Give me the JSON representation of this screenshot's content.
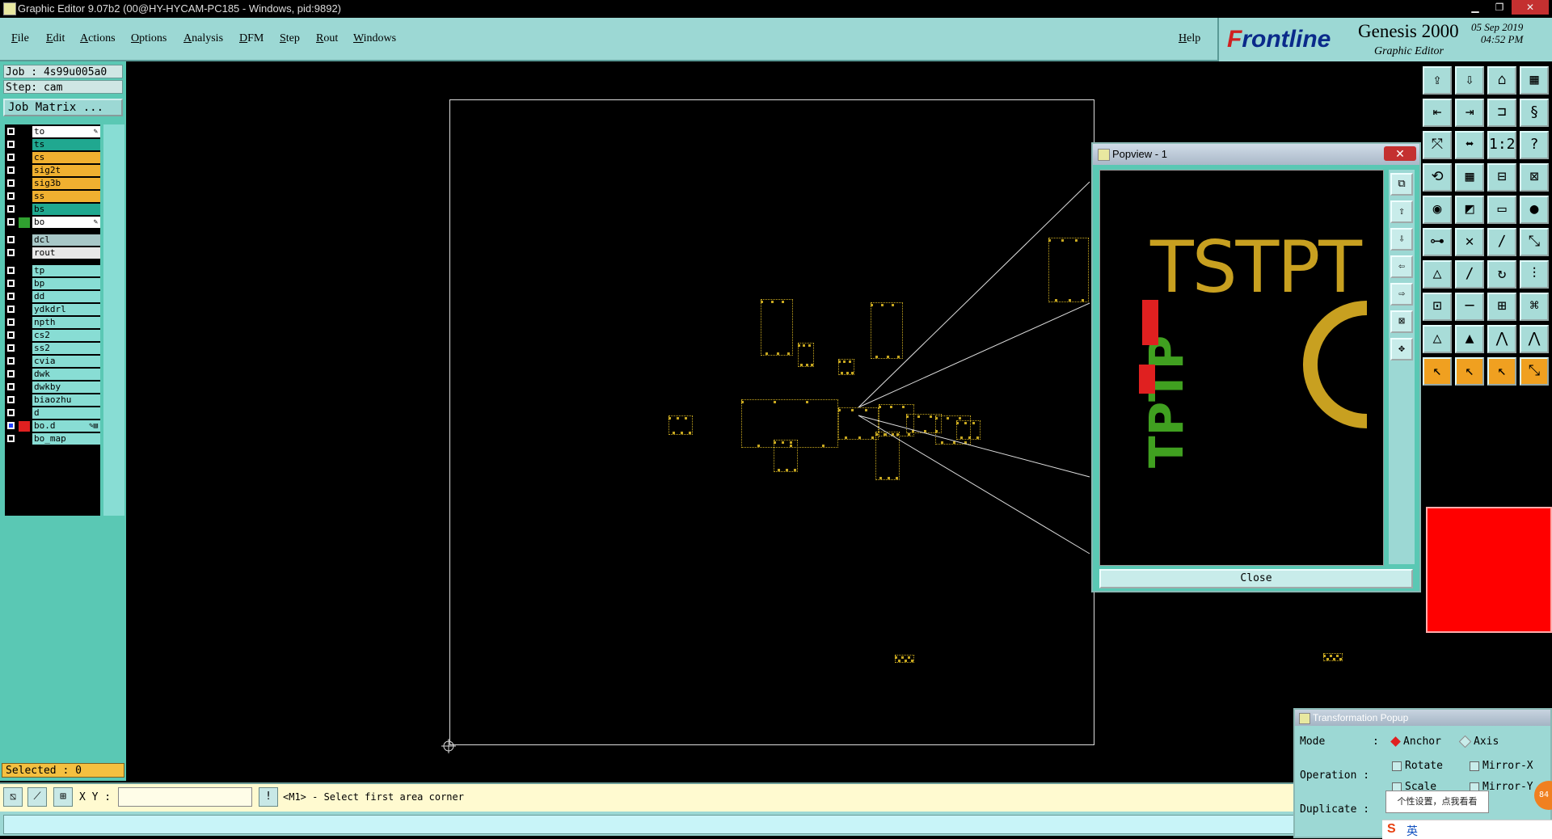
{
  "window": {
    "title": "Graphic Editor 9.07b2 (00@HY-HYCAM-PC185 - Windows, pid:9892)",
    "min": "▁",
    "max": "❐",
    "close": "✕"
  },
  "menu": {
    "items": [
      "File",
      "Edit",
      "Actions",
      "Options",
      "Analysis",
      "DFM",
      "Step",
      "Rout",
      "Windows"
    ],
    "help": "Help"
  },
  "brand": {
    "logo_prefix": "F",
    "logo_rest": "rontline",
    "product": "Genesis 2000",
    "subtitle": "Graphic Editor",
    "date_line1": "05 Sep 2019",
    "date_line2": "04:52 PM"
  },
  "leftpanel": {
    "job": "Job : 4s99u005a0",
    "step": "Step: cam",
    "job_matrix": "Job Matrix ...",
    "selected": "Selected : 0"
  },
  "layers": [
    {
      "name": "to",
      "bg": "#ffffff",
      "swatch": "#000000",
      "pen": "✎"
    },
    {
      "name": "ts",
      "bg": "#20a890",
      "swatch": "#000000"
    },
    {
      "name": "cs",
      "bg": "#f0b030",
      "swatch": "#000000"
    },
    {
      "name": "sig2t",
      "bg": "#f0b030",
      "swatch": "#000000"
    },
    {
      "name": "sig3b",
      "bg": "#f0b030",
      "swatch": "#000000"
    },
    {
      "name": "ss",
      "bg": "#f0b030",
      "swatch": "#000000"
    },
    {
      "name": "bs",
      "bg": "#20a890",
      "swatch": "#000000"
    },
    {
      "name": "bo",
      "bg": "#ffffff",
      "swatch": "#30a030",
      "pen": "✎"
    },
    {
      "name": "dcl",
      "bg": "#a8c8c8",
      "swatch": "#000000"
    },
    {
      "name": "rout",
      "bg": "#e8e8e8",
      "swatch": "#000000"
    },
    {
      "name": "tp",
      "bg": "#88ddd4",
      "swatch": "#000000"
    },
    {
      "name": "bp",
      "bg": "#88ddd4",
      "swatch": "#000000"
    },
    {
      "name": "dd",
      "bg": "#88ddd4",
      "swatch": "#000000"
    },
    {
      "name": "ydkdrl",
      "bg": "#88ddd4",
      "swatch": "#000000"
    },
    {
      "name": "npth",
      "bg": "#88ddd4",
      "swatch": "#000000"
    },
    {
      "name": "cs2",
      "bg": "#88ddd4",
      "swatch": "#000000"
    },
    {
      "name": "ss2",
      "bg": "#88ddd4",
      "swatch": "#000000"
    },
    {
      "name": "cvia",
      "bg": "#88ddd4",
      "swatch": "#000000"
    },
    {
      "name": "dwk",
      "bg": "#88ddd4",
      "swatch": "#000000"
    },
    {
      "name": "dwkby",
      "bg": "#88ddd4",
      "swatch": "#000000"
    },
    {
      "name": "biaozhu",
      "bg": "#88ddd4",
      "swatch": "#000000"
    },
    {
      "name": "d",
      "bg": "#88ddd4",
      "swatch": "#000000"
    },
    {
      "name": "bo.d",
      "bg": "#88ddd4",
      "swatch": "#e02020",
      "pen": "✎▤",
      "checkcolor": "#2040ff"
    },
    {
      "name": "bo_map",
      "bg": "#88ddd4",
      "swatch": "#000000"
    }
  ],
  "command": {
    "xy_label": "X Y :",
    "xy_value": "",
    "prompt": "<M1> - Select first area corner",
    "bang": "!"
  },
  "popview": {
    "title": "Popview - 1",
    "close_label": "Close",
    "text_main": "TSTPT",
    "text_vertical": "TPTP"
  },
  "transform": {
    "title": "Transformation Popup",
    "mode_label": "Mode",
    "mode_opts": [
      "Anchor",
      "Axis"
    ],
    "operation_label": "Operation :",
    "ops": [
      "Rotate",
      "Mirror-X",
      "Scale",
      "Mirror-Y"
    ],
    "duplicate_label": "Duplicate :",
    "colon": ":"
  },
  "tooltip": "个性设置，点我看看",
  "badge": "84",
  "ime": {
    "s": "S",
    "lang": "英"
  },
  "colors": {
    "teal": "#9cd8d4",
    "dark_teal": "#5ac8b4",
    "copper": "#c8a820",
    "board": "#000000"
  }
}
